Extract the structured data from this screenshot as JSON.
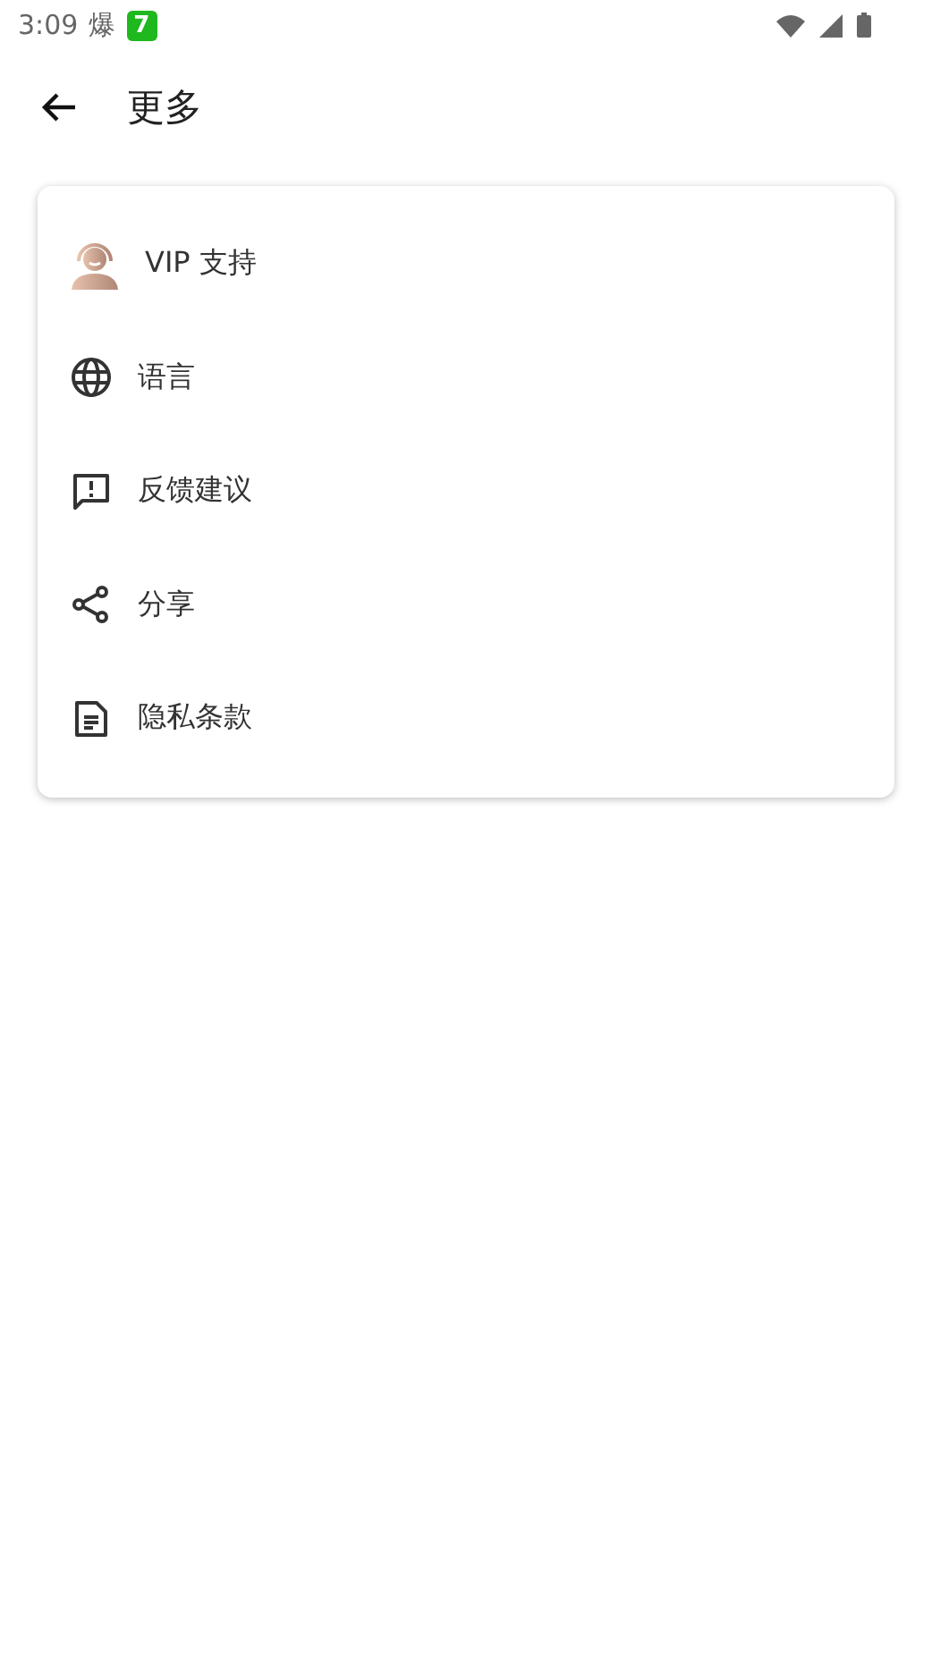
{
  "status_bar": {
    "time": "3:09",
    "notification_text": "爆",
    "badge": "7"
  },
  "header": {
    "title": "更多"
  },
  "menu": [
    {
      "kind": "vip",
      "label": "VIP 支持"
    },
    {
      "kind": "language",
      "label": "语言"
    },
    {
      "kind": "feedback",
      "label": "反馈建议"
    },
    {
      "kind": "share",
      "label": "分享"
    },
    {
      "kind": "privacy",
      "label": "隐私条款"
    }
  ]
}
